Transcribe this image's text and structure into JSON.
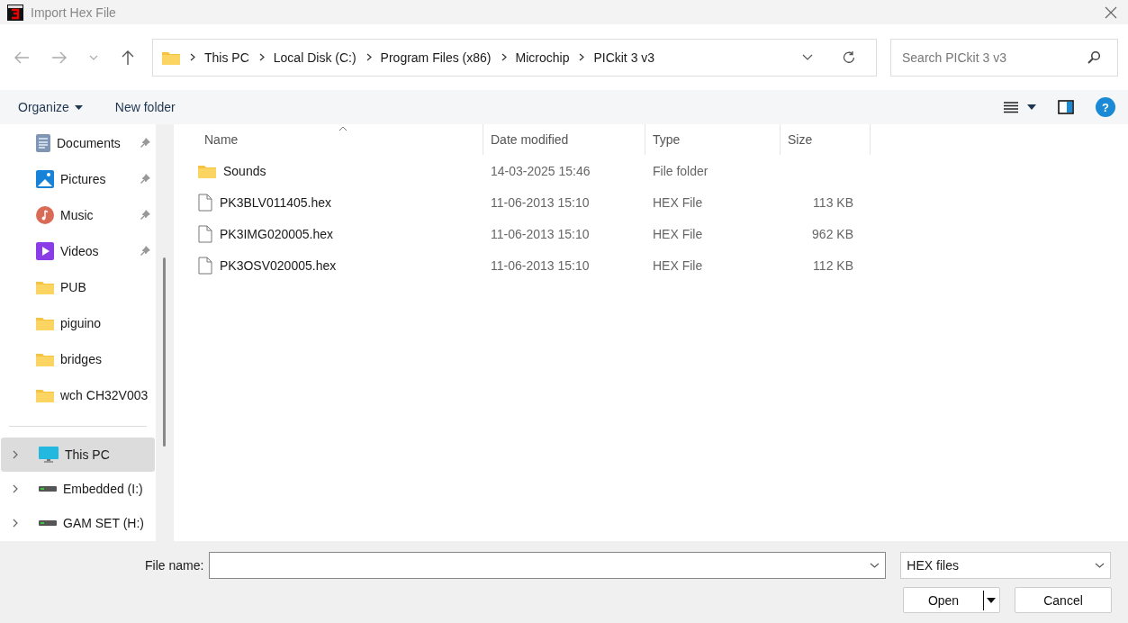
{
  "window": {
    "title": "Import Hex File"
  },
  "address": {
    "crumbs": [
      "This PC",
      "Local Disk (C:)",
      "Program Files (x86)",
      "Microchip",
      "PICkit 3 v3"
    ]
  },
  "search": {
    "placeholder": "Search PICkit 3 v3"
  },
  "toolbar": {
    "organize": "Organize",
    "new_folder": "New folder",
    "help": "?"
  },
  "sidebar": {
    "items": [
      {
        "label": "Documents",
        "kind": "documents",
        "pinned": true
      },
      {
        "label": "Pictures",
        "kind": "pictures",
        "pinned": true
      },
      {
        "label": "Music",
        "kind": "music",
        "pinned": true
      },
      {
        "label": "Videos",
        "kind": "videos",
        "pinned": true
      },
      {
        "label": "PUB",
        "kind": "folder",
        "pinned": false
      },
      {
        "label": "piguino",
        "kind": "folder",
        "pinned": false
      },
      {
        "label": "bridges",
        "kind": "folder",
        "pinned": false
      },
      {
        "label": "wch CH32V003",
        "kind": "folder",
        "pinned": false
      }
    ],
    "drives": [
      {
        "label": "This PC",
        "kind": "pc",
        "selected": true
      },
      {
        "label": "Embedded (I:)",
        "kind": "drive",
        "selected": false
      },
      {
        "label": "GAM SET (H:)",
        "kind": "drive",
        "selected": false
      }
    ]
  },
  "table": {
    "columns": [
      "Name",
      "Date modified",
      "Type",
      "Size"
    ],
    "rows": [
      {
        "name": "Sounds",
        "kind": "folder",
        "date": "14-03-2025 15:46",
        "type": "File folder"
      },
      {
        "name": "PK3BLV011405.hex",
        "kind": "file",
        "date": "11-06-2013 15:10",
        "type": "HEX File",
        "size": "113 KB"
      },
      {
        "name": "PK3IMG020005.hex",
        "kind": "file",
        "date": "11-06-2013 15:10",
        "type": "HEX File",
        "size": "962 KB"
      },
      {
        "name": "PK3OSV020005.hex",
        "kind": "file",
        "date": "11-06-2013 15:10",
        "type": "HEX File",
        "size": "112 KB"
      }
    ]
  },
  "footer": {
    "file_name_label": "File name:",
    "file_type": "HEX files",
    "open": "Open",
    "cancel": "Cancel"
  }
}
